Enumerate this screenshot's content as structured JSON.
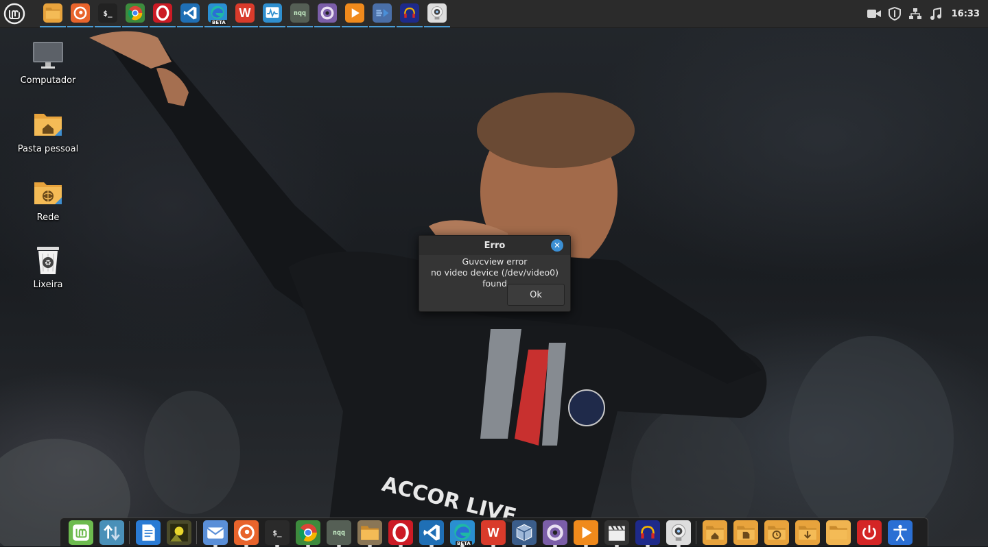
{
  "top_panel": {
    "menu_icon": "linux-mint-menu-icon",
    "launchers": [
      {
        "name": "files",
        "icon": "folder-icon",
        "color": "#e8a33c"
      },
      {
        "name": "firefox",
        "icon": "firefox-icon",
        "color": "#e8642c"
      },
      {
        "name": "terminal",
        "icon": "terminal-icon",
        "color": "#222222",
        "label": "$_"
      },
      {
        "name": "chrome",
        "icon": "chrome-icon",
        "color": "#3d8b3d"
      },
      {
        "name": "opera",
        "icon": "opera-icon",
        "color": "#cc1b25"
      },
      {
        "name": "vscode",
        "icon": "vscode-icon",
        "color": "#1f6fb5"
      },
      {
        "name": "edge-beta",
        "icon": "edge-beta-icon",
        "color": "#2a8fd1",
        "badge": "BETA"
      },
      {
        "name": "wps-office",
        "icon": "wps-icon",
        "color": "#d93b2b",
        "label": "W"
      },
      {
        "name": "system-monitor",
        "icon": "monitor-icon",
        "color": "#2f8fcf"
      },
      {
        "name": "nqq",
        "icon": "nqq-icon",
        "color": "#555f55",
        "label": "nqq"
      },
      {
        "name": "webcamoid",
        "icon": "webcamoid-icon",
        "color": "#7b5ea8"
      },
      {
        "name": "vlc-player",
        "icon": "play-icon",
        "color": "#f08a1c"
      },
      {
        "name": "audio-tool",
        "icon": "audio-icon",
        "color": "#4a6fa8"
      },
      {
        "name": "headset-app",
        "icon": "headset-icon",
        "color": "#1e2a8a"
      },
      {
        "name": "guvcview",
        "icon": "webcam-icon",
        "color": "#dddddd"
      }
    ],
    "tray": {
      "clock": "16:33",
      "icons": [
        "camera-icon",
        "shield-icon",
        "network-icon",
        "music-icon"
      ]
    }
  },
  "desktop": {
    "icons": [
      {
        "label": "Computador",
        "icon": "computer-icon"
      },
      {
        "label": "Pasta pessoal",
        "icon": "home-folder-icon"
      },
      {
        "label": "Rede",
        "icon": "network-folder-icon"
      },
      {
        "label": "Lixeira",
        "icon": "trash-icon"
      }
    ]
  },
  "dialog": {
    "title": "Erro",
    "message_line1": "Guvcview error",
    "message_line2": "no video device (/dev/video0) found",
    "ok_label": "Ok"
  },
  "dock": {
    "items": [
      {
        "name": "mint-menu",
        "icon": "mint-icon",
        "color": "#6dbb4f"
      },
      {
        "name": "update-manager",
        "icon": "update-icon",
        "color": "#4a90b8"
      },
      {
        "name": "document-viewer",
        "icon": "document-icon",
        "color": "#2a7bd4"
      },
      {
        "name": "image-viewer",
        "icon": "image-icon",
        "color": "#4a4a2a"
      },
      {
        "name": "mail",
        "icon": "mail-icon",
        "color": "#5a8fd8"
      },
      {
        "name": "firefox",
        "icon": "firefox-icon",
        "color": "#e8642c"
      },
      {
        "name": "terminal",
        "icon": "terminal-icon",
        "color": "#2a2a2a",
        "label": "$_"
      },
      {
        "name": "chrome",
        "icon": "chrome-icon",
        "color": "#3d8b3d"
      },
      {
        "name": "nqq",
        "icon": "nqq-icon",
        "color": "#555f55",
        "label": "nqq"
      },
      {
        "name": "files",
        "icon": "folder-icon",
        "color": "#8a7656"
      },
      {
        "name": "opera",
        "icon": "opera-icon",
        "color": "#cc1b25"
      },
      {
        "name": "vscode",
        "icon": "vscode-icon",
        "color": "#1f6fb5"
      },
      {
        "name": "edge-beta",
        "icon": "edge-beta-icon",
        "color": "#2a8fd1",
        "badge": "BETA"
      },
      {
        "name": "wps-office",
        "icon": "wps-icon",
        "color": "#d93b2b",
        "label": "W"
      },
      {
        "name": "virtualbox",
        "icon": "virtualbox-icon",
        "color": "#3b5d8a"
      },
      {
        "name": "webcamoid",
        "icon": "webcamoid-icon",
        "color": "#7b5ea8"
      },
      {
        "name": "vlc-player",
        "icon": "play-icon",
        "color": "#f08a1c"
      },
      {
        "name": "video-editor",
        "icon": "clapper-icon",
        "color": "#333333"
      },
      {
        "name": "headset-app",
        "icon": "headset-icon",
        "color": "#1e2a8a"
      },
      {
        "name": "guvcview",
        "icon": "webcam-icon",
        "color": "#dddddd"
      },
      {
        "name": "home-folder",
        "icon": "home-folder-icon",
        "color": "#e8a33c"
      },
      {
        "name": "documents-folder",
        "icon": "documents-folder-icon",
        "color": "#e8a33c"
      },
      {
        "name": "recent-folder",
        "icon": "recent-folder-icon",
        "color": "#e8a33c"
      },
      {
        "name": "downloads-folder",
        "icon": "downloads-folder-icon",
        "color": "#e8a33c"
      },
      {
        "name": "folder",
        "icon": "folder-icon",
        "color": "#f0b450"
      },
      {
        "name": "shutdown",
        "icon": "power-icon",
        "color": "#d42525"
      },
      {
        "name": "accessibility",
        "icon": "accessibility-icon",
        "color": "#2a6fd4"
      }
    ]
  }
}
